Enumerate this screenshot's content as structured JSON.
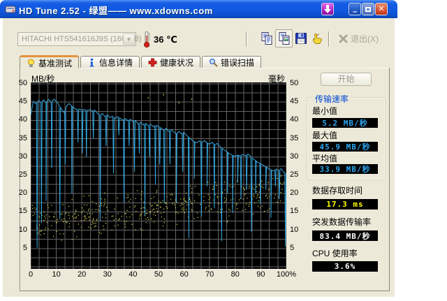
{
  "window": {
    "title": "HD Tune 2.52 - 绿盟—— www.xdowns.com",
    "buttons": {
      "download": "↓",
      "minimize": "–",
      "maximize": "□",
      "close": "✕"
    }
  },
  "toolbar": {
    "drive_selector": {
      "value": "HITACHI HTS541616J9S (160 GB)"
    },
    "temperature": "36 ℃",
    "buttons": [
      "copy-text-icon",
      "copy-screenshot-icon",
      "save-icon",
      "options-hand-icon"
    ],
    "exit_label": "退出(X)"
  },
  "tabs": [
    {
      "label": "基准测试",
      "icon": "lightbulb-icon",
      "active": true
    },
    {
      "label": "信息详情",
      "icon": "info-icon",
      "active": false
    },
    {
      "label": "健康状况",
      "icon": "health-cross-icon",
      "active": false
    },
    {
      "label": "错误扫描",
      "icon": "magnifier-icon",
      "active": false
    }
  ],
  "panel": {
    "start_label": "开始",
    "transfer_rate_group": {
      "title": "传输速率",
      "fields": [
        {
          "label": "最小值",
          "value": "5.2 MB/秒",
          "color": "#2ea6f0"
        },
        {
          "label": "最大值",
          "value": "45.9 MB/秒",
          "color": "#2ea6f0"
        },
        {
          "label": "平均值",
          "value": "33.9 MB/秒",
          "color": "#2ea6f0"
        }
      ]
    },
    "extra_fields": [
      {
        "label": "数据存取时间",
        "value": "17.3 ms",
        "color": "#ffff00"
      },
      {
        "label": "突发数据传输率",
        "value": "83.4 MB/秒",
        "color": "#ffffff"
      },
      {
        "label": "CPU 使用率",
        "value": "3.6%",
        "color": "#ffffff"
      }
    ]
  },
  "chart_data": {
    "type": "line+scatter",
    "title": "",
    "left_axis": {
      "label": "MB/秒",
      "min": 0,
      "max": 50,
      "ticks": [
        50,
        45,
        40,
        35,
        30,
        25,
        20,
        15,
        10,
        5
      ]
    },
    "right_axis": {
      "label": "毫秒",
      "min": 0,
      "max": 50,
      "ticks": [
        50,
        45,
        40,
        35,
        30,
        25,
        20,
        15,
        10,
        5
      ]
    },
    "x_axis": {
      "min": 0,
      "max": 100,
      "tick_labels": [
        "0",
        "10",
        "20",
        "30",
        "40",
        "50",
        "60",
        "70",
        "80",
        "90",
        "100%"
      ]
    },
    "grid": {
      "bg": "#000000",
      "color": "#666666",
      "v_step_pct": 3.3333,
      "h_step": 2.5
    },
    "series": [
      {
        "name": "transfer-rate",
        "type": "line",
        "color": "#35a8e0",
        "axis": "left",
        "values_by_percent": [
          41.5,
          45.2,
          44.6,
          45.4,
          44.8,
          45.6,
          44.9,
          45.7,
          45.0,
          45.8,
          45.2,
          44.3,
          43.1,
          42.2,
          43.9,
          44.6,
          44.0,
          43.4,
          42.9,
          43.1,
          42.8,
          43.0,
          42.7,
          42.9,
          42.6,
          42.8,
          42.0,
          41.4,
          41.9,
          41.1,
          41.5,
          40.8,
          41.2,
          40.5,
          41.0,
          40.6,
          40.1,
          40.5,
          39.9,
          40.3,
          39.7,
          40.0,
          39.0,
          39.5,
          38.8,
          39.2,
          38.5,
          38.9,
          38.3,
          38.6,
          38.4,
          37.9,
          37.3,
          37.8,
          37.0,
          37.5,
          36.8,
          36.3,
          37.0,
          36.4,
          36.7,
          35.9,
          35.3,
          34.7,
          34.2,
          33.9,
          34.4,
          34.0,
          34.5,
          33.8,
          33.5,
          34.0,
          33.3,
          33.7,
          32.9,
          32.3,
          31.8,
          31.3,
          30.8,
          30.4,
          30.2,
          30.5,
          30.3,
          30.7,
          30.4,
          30.8,
          30.2,
          29.5,
          29.0,
          28.5,
          28.2,
          27.7,
          27.3,
          26.9,
          26.5,
          26.2,
          26.7,
          26.3,
          26.8,
          25.9,
          25.4
        ],
        "spikes": [
          [
            2.5,
            5.2
          ],
          [
            4.2,
            12
          ],
          [
            6,
            18
          ],
          [
            8.2,
            27
          ],
          [
            11.4,
            13
          ],
          [
            13.5,
            28
          ],
          [
            16.1,
            20
          ],
          [
            18.5,
            34
          ],
          [
            20.2,
            31
          ],
          [
            21.8,
            30
          ],
          [
            24.5,
            35
          ],
          [
            27.2,
            12.5
          ],
          [
            29.5,
            33
          ],
          [
            32.4,
            25.5
          ],
          [
            34.5,
            36
          ],
          [
            36.5,
            17.5
          ],
          [
            38.5,
            33
          ],
          [
            40.6,
            26
          ],
          [
            42.5,
            31
          ],
          [
            44.7,
            14
          ],
          [
            46.5,
            30
          ],
          [
            48.8,
            22.5
          ],
          [
            50.5,
            28
          ],
          [
            52.3,
            17.4
          ],
          [
            54.5,
            28
          ],
          [
            57,
            17.5
          ],
          [
            59.5,
            26
          ],
          [
            61.9,
            7.8
          ],
          [
            64,
            24
          ],
          [
            66.8,
            13.7
          ],
          [
            69,
            22
          ],
          [
            71.9,
            16
          ],
          [
            74.7,
            7
          ],
          [
            77,
            20
          ],
          [
            79,
            14.7
          ],
          [
            81,
            23
          ],
          [
            82.3,
            18.5
          ],
          [
            84.5,
            21
          ],
          [
            86.4,
            9.6
          ],
          [
            88,
            20
          ],
          [
            89.9,
            17.2
          ],
          [
            92,
            21
          ],
          [
            94,
            13.4
          ],
          [
            95.8,
            22
          ],
          [
            97.3,
            18.5
          ],
          [
            99.7,
            5.5
          ]
        ]
      },
      {
        "name": "access-time",
        "type": "scatter",
        "color": "#e6e65c",
        "axis": "right",
        "generated": {
          "seed": 42,
          "count": 430,
          "x_min": 0.5,
          "x_max": 99.5,
          "center_start": 12,
          "center_end": 20,
          "spread": 4.5,
          "y_min": 6.5,
          "y_max": 24.8
        },
        "outliers": [
          [
            46,
            46.2
          ],
          [
            52,
            47.0
          ],
          [
            58,
            44.8
          ],
          [
            63,
            45.8
          ]
        ]
      }
    ],
    "readouts": {
      "min_mbs": 5.2,
      "max_mbs": 45.9,
      "avg_mbs": 33.9,
      "access_time_ms": 17.3,
      "burst_rate_mbs": 83.4,
      "cpu_usage_pct": 3.6
    }
  }
}
